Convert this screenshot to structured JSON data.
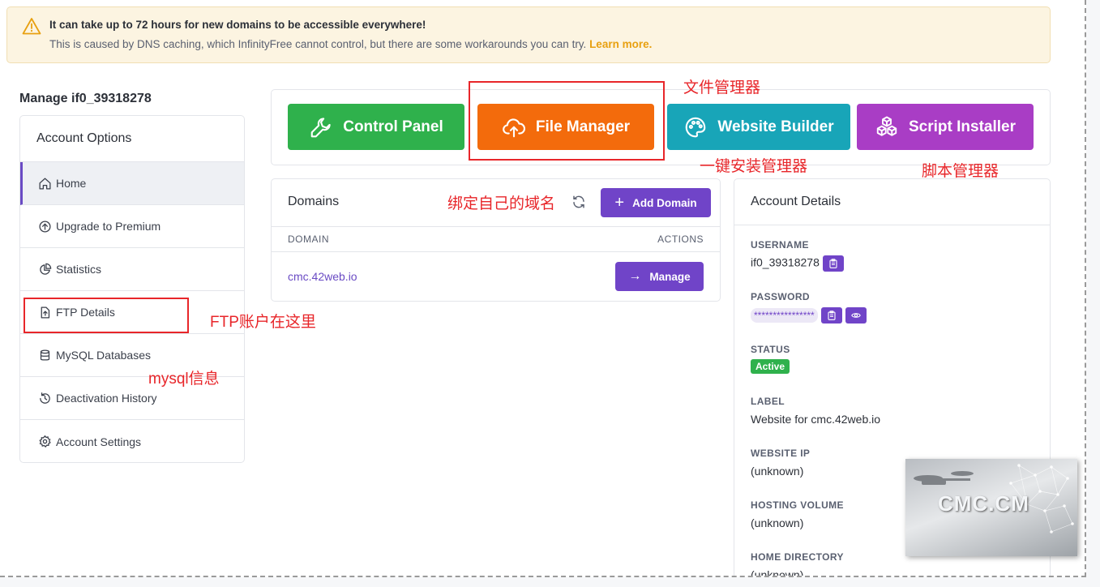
{
  "alert": {
    "title": "It can take up to 72 hours for new domains to be accessible everywhere!",
    "body": "This is caused by DNS caching, which InfinityFree cannot control, but there are some workarounds you can try. ",
    "link": "Learn more."
  },
  "page_title": "Manage if0_39318278",
  "sidebar": {
    "heading": "Account Options",
    "items": [
      {
        "label": "Home",
        "icon": "home-icon"
      },
      {
        "label": "Upgrade to Premium",
        "icon": "arrow-up-circle-icon"
      },
      {
        "label": "Statistics",
        "icon": "pie-chart-icon"
      },
      {
        "label": "FTP Details",
        "icon": "file-upload-icon"
      },
      {
        "label": "MySQL Databases",
        "icon": "database-icon"
      },
      {
        "label": "Deactivation History",
        "icon": "history-icon"
      },
      {
        "label": "Account Settings",
        "icon": "gear-icon"
      }
    ]
  },
  "quick_links": {
    "control_panel": "Control Panel",
    "file_manager": "File Manager",
    "website_builder": "Website Builder",
    "script_installer": "Script Installer"
  },
  "domains": {
    "title": "Domains",
    "add_button": "Add Domain",
    "col_domain": "DOMAIN",
    "col_actions": "ACTIONS",
    "rows": [
      {
        "domain": "cmc.42web.io",
        "action": "Manage"
      }
    ]
  },
  "account_details": {
    "title": "Account Details",
    "username_label": "USERNAME",
    "username": "if0_39318278",
    "password_label": "PASSWORD",
    "password_mask": "****************",
    "status_label": "STATUS",
    "status": "Active",
    "label_label": "LABEL",
    "label": "Website for cmc.42web.io",
    "ip_label": "WEBSITE IP",
    "ip": "(unknown)",
    "volume_label": "HOSTING VOLUME",
    "volume": "(unknown)",
    "home_dir_label": "HOME DIRECTORY",
    "home_dir": "(unknown)"
  },
  "annotations": {
    "file_manager": "文件管理器",
    "one_click": "一键安装管理器",
    "script_manager": "脚本管理器",
    "bind_domain": "绑定自己的域名",
    "ftp": "FTP账户在这里",
    "mysql": "mysql信息"
  },
  "watermark": "CMC.CM",
  "colors": {
    "accent_purple": "#7044c8",
    "control_panel": "#2fb14c",
    "file_manager": "#f36b0c",
    "website_builder": "#18a5b8",
    "script_installer": "#a93dc5",
    "annotation_red": "#e8262a"
  }
}
